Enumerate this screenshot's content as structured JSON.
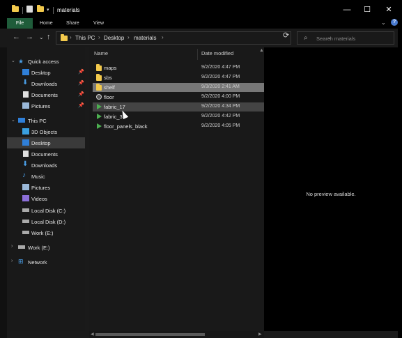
{
  "window": {
    "title": "materials",
    "controls": {
      "minimize": "—",
      "maximize": "☐",
      "close": "✕"
    }
  },
  "ribbon": {
    "tabs": [
      "File",
      "Home",
      "Share",
      "View"
    ],
    "expand_icon": "⌄",
    "help_icon": "?"
  },
  "nav": {
    "back": "←",
    "forward": "→",
    "recent": "⌄",
    "up": "↑",
    "breadcrumbs": [
      "This PC",
      "Desktop",
      "materials"
    ],
    "dropdown": "⌄",
    "refresh": "⟳",
    "search_placeholder": "Search materials"
  },
  "navpane": {
    "quick_access": "Quick access",
    "quick_items": [
      {
        "label": "Desktop",
        "icon": "desktop-icon"
      },
      {
        "label": "Downloads",
        "icon": "download-icon"
      },
      {
        "label": "Documents",
        "icon": "document-icon"
      },
      {
        "label": "Pictures",
        "icon": "pictures-icon"
      }
    ],
    "this_pc": "This PC",
    "pc_items": [
      {
        "label": "3D Objects",
        "icon": "3d-objects-icon"
      },
      {
        "label": "Desktop",
        "icon": "desktop-icon"
      },
      {
        "label": "Documents",
        "icon": "document-icon"
      },
      {
        "label": "Downloads",
        "icon": "download-icon"
      },
      {
        "label": "Music",
        "icon": "music-icon"
      },
      {
        "label": "Pictures",
        "icon": "pictures-icon"
      },
      {
        "label": "Videos",
        "icon": "videos-icon"
      },
      {
        "label": "Local Disk (C:)",
        "icon": "drive-icon"
      },
      {
        "label": "Local Disk (D:)",
        "icon": "drive-icon"
      },
      {
        "label": "Work (E:)",
        "icon": "drive-icon"
      }
    ],
    "work_drive": "Work (E:)",
    "network": "Network"
  },
  "files": {
    "columns": [
      "Name",
      "Date modified"
    ],
    "rows": [
      {
        "name": "maps",
        "date": "9/2/2020 4:47 PM",
        "type": "folder"
      },
      {
        "name": "sbs",
        "date": "9/2/2020 4:47 PM",
        "type": "folder"
      },
      {
        "name": "shelf",
        "date": "9/3/2020 2:41 AM",
        "type": "folder"
      },
      {
        "name": "floor",
        "date": "9/2/2020 4:00 PM",
        "type": "substance"
      },
      {
        "name": "fabric_17",
        "date": "9/2/2020 4:34 PM",
        "type": "sbsar"
      },
      {
        "name": "fabric_3",
        "date": "9/2/2020 4:42 PM",
        "type": "sbsar"
      },
      {
        "name": "floor_panels_black",
        "date": "9/2/2020 4:05 PM",
        "type": "sbsar"
      }
    ]
  },
  "preview": {
    "text": "No preview available."
  },
  "colors": {
    "accent_file_tab": "#1f5c3a",
    "folder": "#f2c94c",
    "sbsar": "#4caf50",
    "selected_row": "#777777"
  }
}
